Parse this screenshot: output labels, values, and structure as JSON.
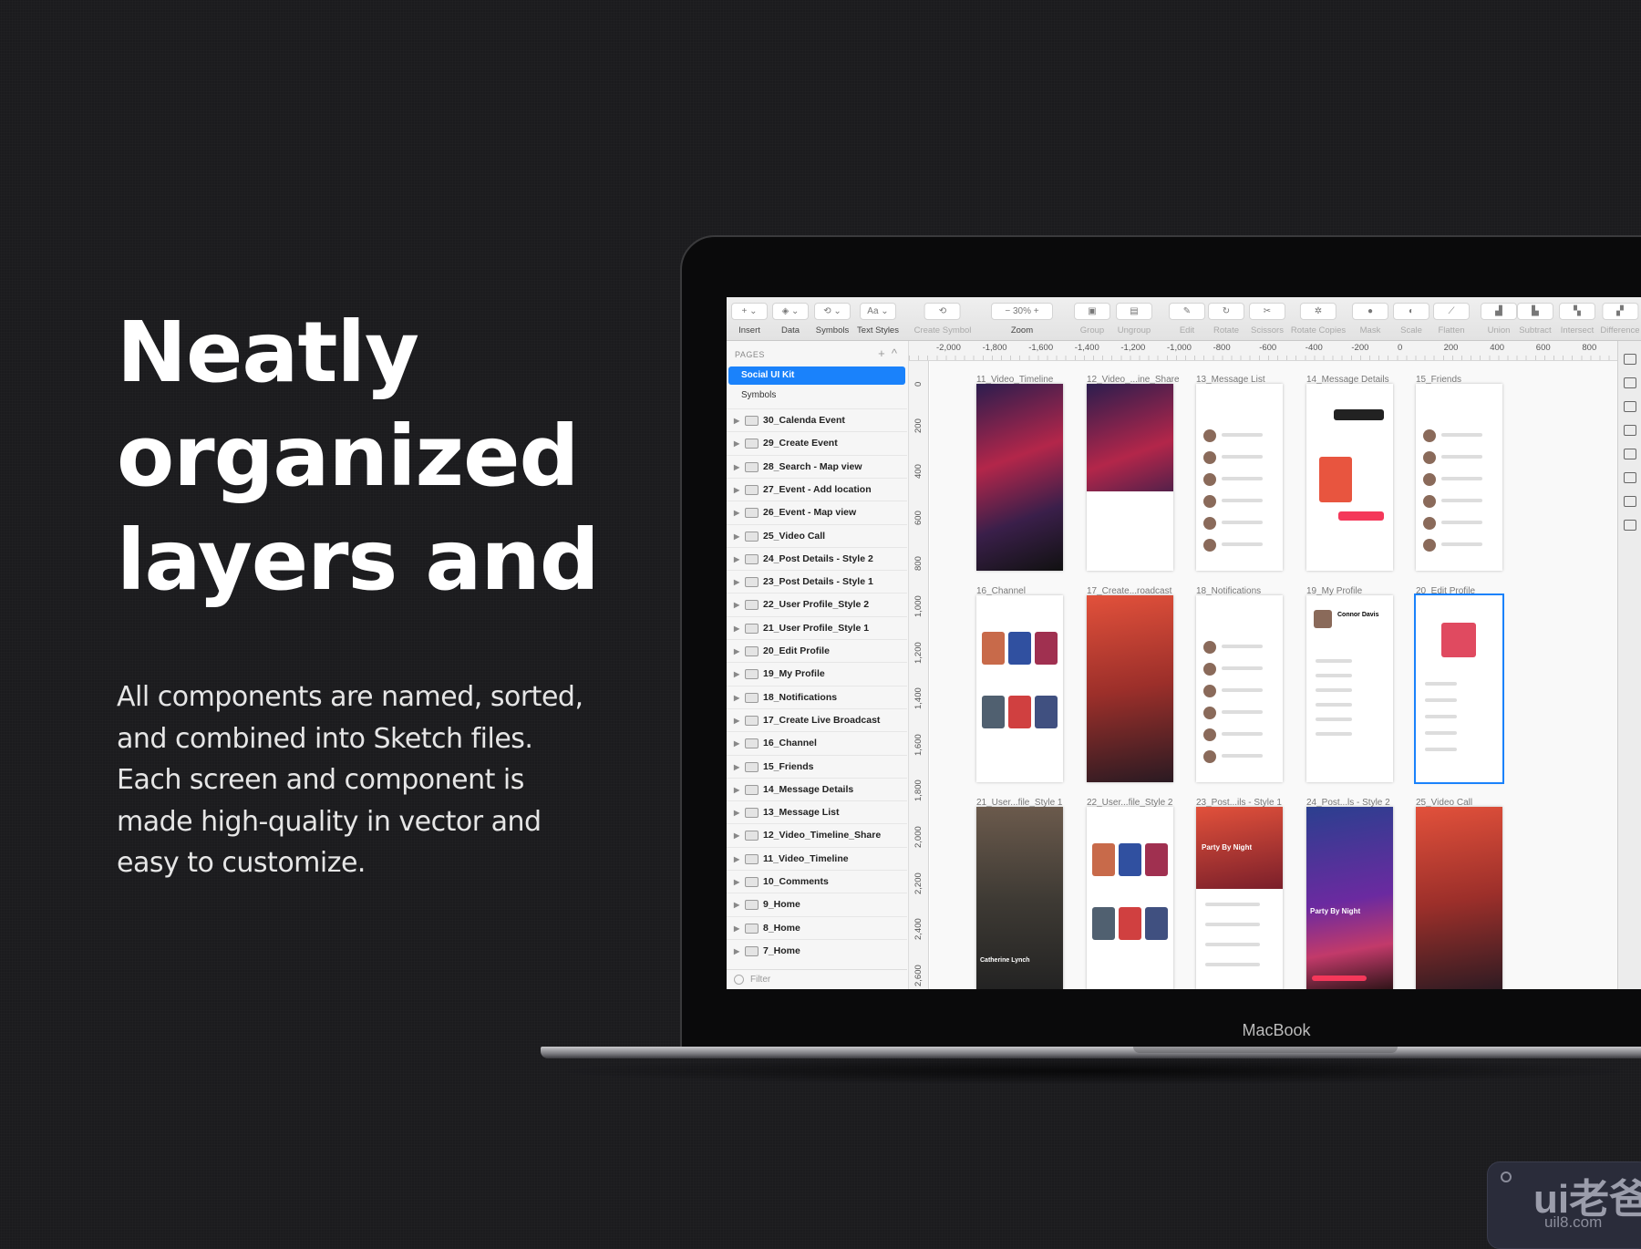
{
  "headline": [
    "Neatly",
    "organized",
    "layers and"
  ],
  "paragraph": [
    "All components are named, sorted,",
    "and combined into Sketch files.",
    "Each screen and component is",
    "made high-quality in vector and",
    "easy to customize."
  ],
  "device_label": "MacBook",
  "toolbar": {
    "items": [
      {
        "label": "Insert",
        "btn": "+ ⌄"
      },
      {
        "label": "Data",
        "btn": "◈ ⌄"
      },
      {
        "label": "Symbols",
        "btn": "⟲ ⌄"
      },
      {
        "label": "Text Styles",
        "btn": "Aa ⌄"
      },
      {
        "label": "Create Symbol",
        "btn": "⟲"
      },
      {
        "label": "Zoom",
        "btn": "−  30%  +"
      },
      {
        "label": "Group",
        "btn": "▣"
      },
      {
        "label": "Ungroup",
        "btn": "▤"
      },
      {
        "label": "Edit",
        "btn": "✎"
      },
      {
        "label": "Rotate",
        "btn": "↻"
      },
      {
        "label": "Scissors",
        "btn": "✂"
      },
      {
        "label": "Rotate Copies",
        "btn": "✲"
      },
      {
        "label": "Mask",
        "btn": "●"
      },
      {
        "label": "Scale",
        "btn": "◐"
      },
      {
        "label": "Flatten",
        "btn": "⟋"
      },
      {
        "label": "Union",
        "btn": "▟"
      },
      {
        "label": "Subtract",
        "btn": "▙"
      },
      {
        "label": "Intersect",
        "btn": "▚"
      },
      {
        "label": "Difference",
        "btn": "▞"
      }
    ],
    "zoom_value": "30%"
  },
  "pages": {
    "header": "PAGES",
    "add": "+",
    "collapse": "^",
    "items": [
      "Social UI Kit",
      "Symbols"
    ],
    "selected": "Social UI Kit"
  },
  "layers": [
    "30_Calenda Event",
    "29_Create Event",
    "28_Search - Map view",
    "27_Event - Add location",
    "26_Event - Map view",
    "25_Video Call",
    "24_Post Details - Style 2",
    "23_Post Details - Style 1",
    "22_User Profile_Style 2",
    "21_User Profile_Style 1",
    "20_Edit Profile",
    "19_My Profile",
    "18_Notifications",
    "17_Create Live Broadcast",
    "16_Channel",
    "15_Friends",
    "14_Message Details",
    "13_Message List",
    "12_Video_Timeline_Share",
    "11_Video_Timeline",
    "10_Comments",
    "9_Home",
    "8_Home",
    "7_Home"
  ],
  "filter_placeholder": "Filter",
  "ruler_h": [
    "-2,000",
    "-1,800",
    "-1,600",
    "-1,400",
    "-1,200",
    "-1,000",
    "-800",
    "-600",
    "-400",
    "-200",
    "0",
    "200",
    "400",
    "600",
    "800"
  ],
  "ruler_v": [
    "0",
    "200",
    "400",
    "600",
    "800",
    "1,000",
    "1,200",
    "1,400",
    "1,600",
    "1,800",
    "2,000",
    "2,200",
    "2,400",
    "2,600"
  ],
  "artboards": [
    {
      "title": "11_Video_Timeline",
      "style": "dark"
    },
    {
      "title": "12_Video_...ine_Share",
      "style": "dark-share"
    },
    {
      "title": "13_Message List",
      "style": "list"
    },
    {
      "title": "14_Message Details",
      "style": "chat"
    },
    {
      "title": "15_Friends",
      "style": "list"
    },
    {
      "title": "16_Channel",
      "style": "grid"
    },
    {
      "title": "17_Create...roadcast",
      "style": "warm"
    },
    {
      "title": "18_Notifications",
      "style": "list"
    },
    {
      "title": "19_My Profile",
      "style": "profile"
    },
    {
      "title": "20_Edit Profile",
      "style": "edit"
    },
    {
      "title": "21_User...file_Style 1",
      "style": "photo"
    },
    {
      "title": "22_User...file_Style 2",
      "style": "grid"
    },
    {
      "title": "23_Post...ils - Style 1",
      "style": "post"
    },
    {
      "title": "24_Post...ls - Style 2",
      "style": "blue"
    },
    {
      "title": "25_Video Call",
      "style": "warm"
    }
  ],
  "artboard_texts": {
    "connor": "Connor Davis",
    "party": "Party By Night",
    "catherine": "Catherine Lynch"
  },
  "watermark": {
    "brand": "ui老爸",
    "url": "uil8.com"
  },
  "colors": {
    "accent": "#1a82fb",
    "brand_red": "#f4385a",
    "background": "#1b1b1e"
  }
}
